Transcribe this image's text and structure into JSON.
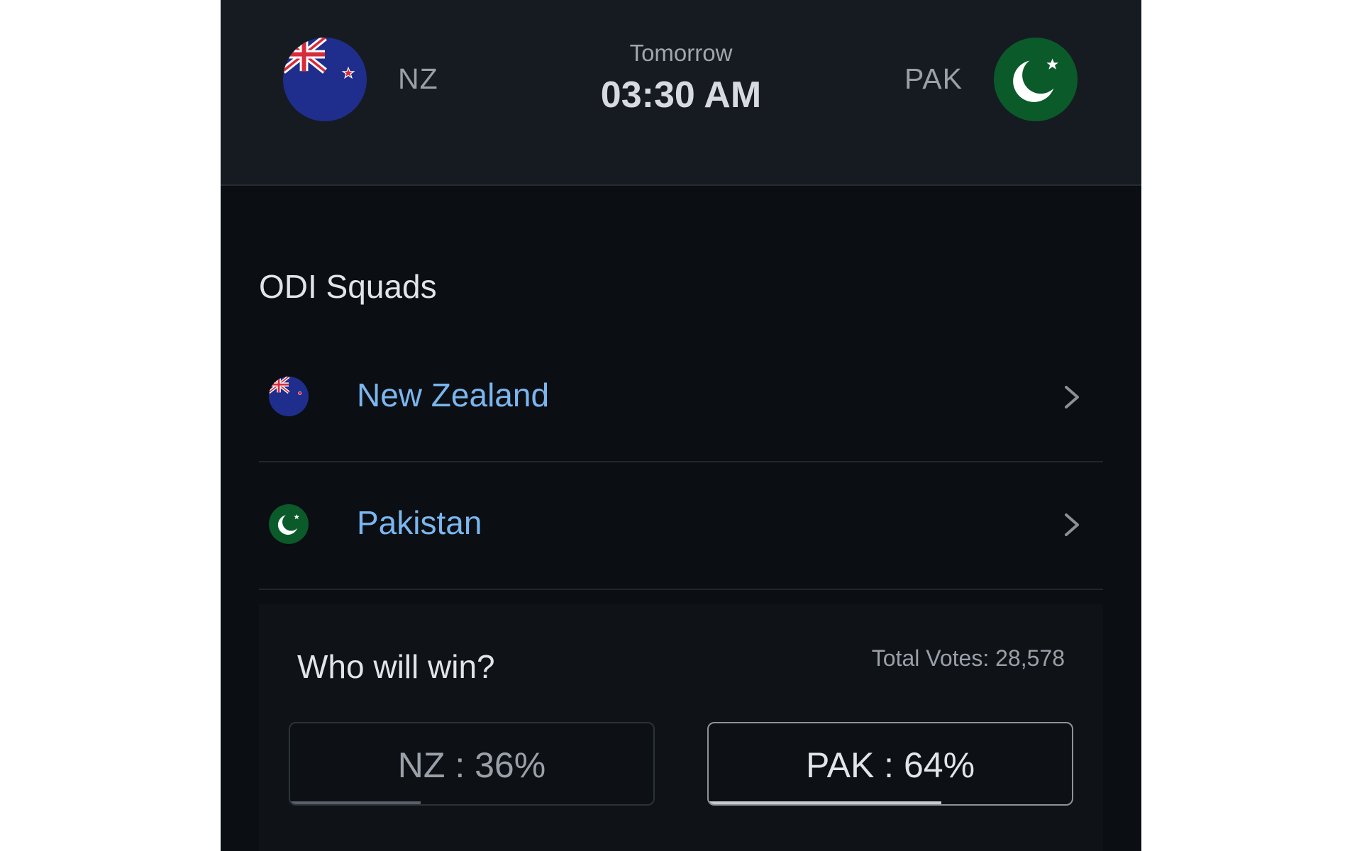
{
  "header": {
    "home": {
      "code": "NZ",
      "flag_icon": "nz-flag-icon"
    },
    "away": {
      "code": "PAK",
      "flag_icon": "pak-flag-icon"
    },
    "day_label": "Tomorrow",
    "time": "03:30 AM"
  },
  "squads": {
    "title": "ODI Squads",
    "items": [
      {
        "name": "New Zealand",
        "flag_icon": "nz-flag-icon",
        "chevron_icon": "chevron-right-icon"
      },
      {
        "name": "Pakistan",
        "flag_icon": "pak-flag-icon",
        "chevron_icon": "chevron-right-icon"
      }
    ]
  },
  "poll": {
    "question": "Who will win?",
    "total_votes": "Total Votes: 28,578",
    "options": [
      {
        "label": "NZ : 36%",
        "percent": 36,
        "selected": false
      },
      {
        "label": "PAK : 64%",
        "percent": 64,
        "selected": true
      }
    ]
  },
  "colors": {
    "header_bg": "#161b22",
    "page_bg": "#0b0e12",
    "link_blue": "#7ab6f0",
    "pak_green": "#0b5a2a",
    "nz_blue": "#1f2e8c",
    "nz_red": "#d62b3a"
  }
}
